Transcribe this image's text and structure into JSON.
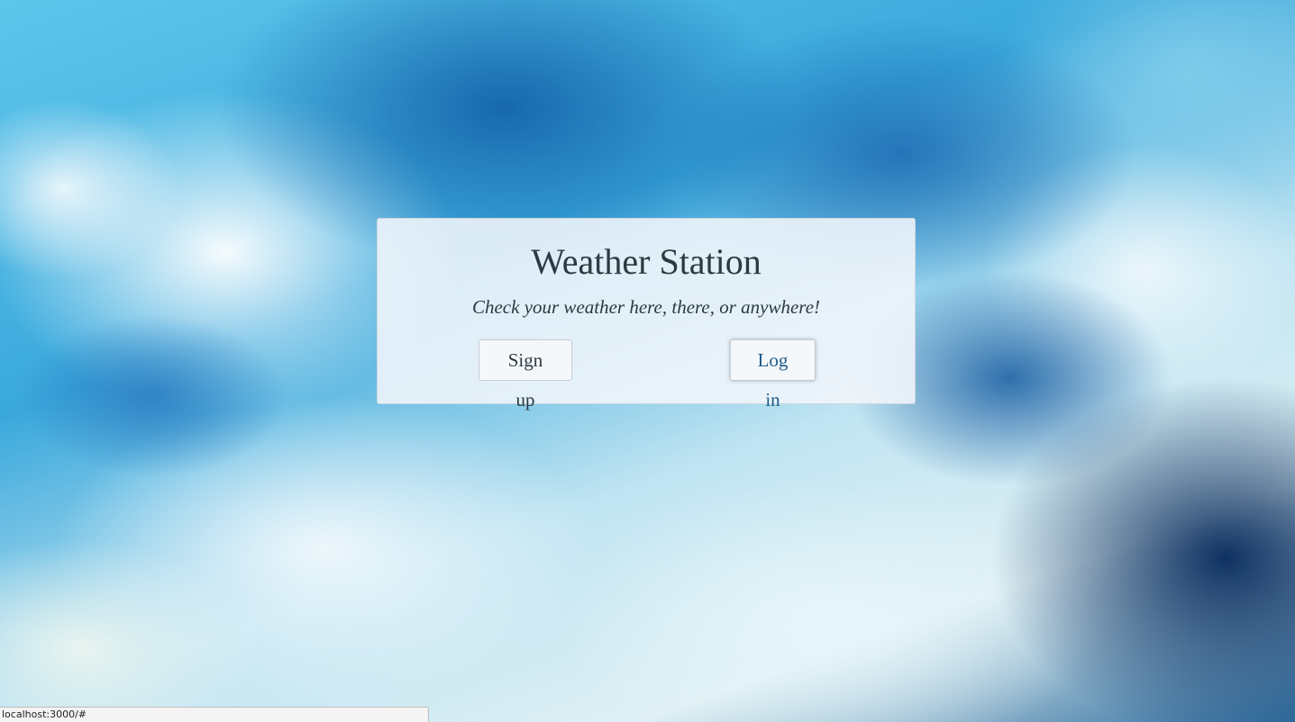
{
  "card": {
    "title": "Weather Station",
    "subtitle": "Check your weather here, there, or anywhere!",
    "signup_label": "Sign up",
    "login_label": "Log in"
  },
  "status_bar": {
    "url": "localhost:3000/#"
  },
  "colors": {
    "text": "#2b3a42",
    "link": "#1f5a8c",
    "card_bg": "#f2f6fa"
  }
}
